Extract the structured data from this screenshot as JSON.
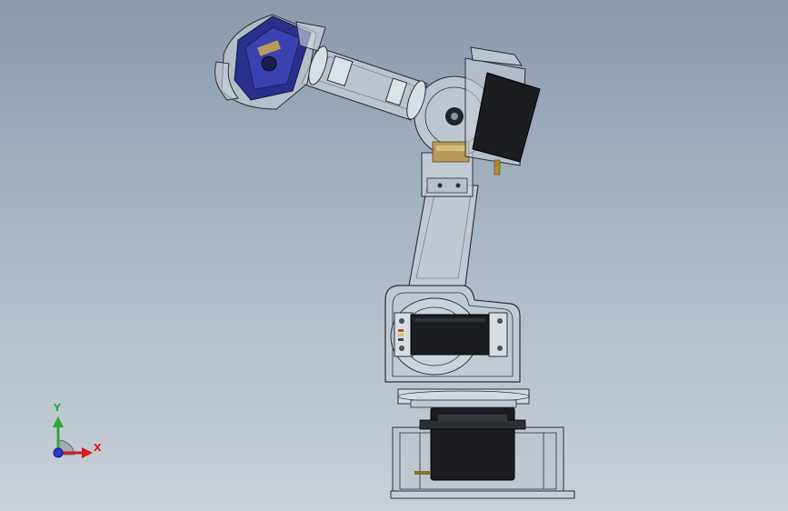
{
  "triad": {
    "x_label": "X",
    "y_label": "Y"
  },
  "colors": {
    "background_top": "#8a9aab",
    "background_bottom": "#c9d1d8",
    "edge": "#2a2f36",
    "glass_fill": "#c9d2dc",
    "servo_black": "#1b1d20",
    "gripper_blue": "#2a2f8c",
    "servo_gold": "#b89a5a",
    "axis_x": "#d21c1c",
    "axis_y": "#2aa838",
    "axis_z": "#1f3bd6"
  },
  "icons": [
    "coordinate-triad-icon"
  ]
}
